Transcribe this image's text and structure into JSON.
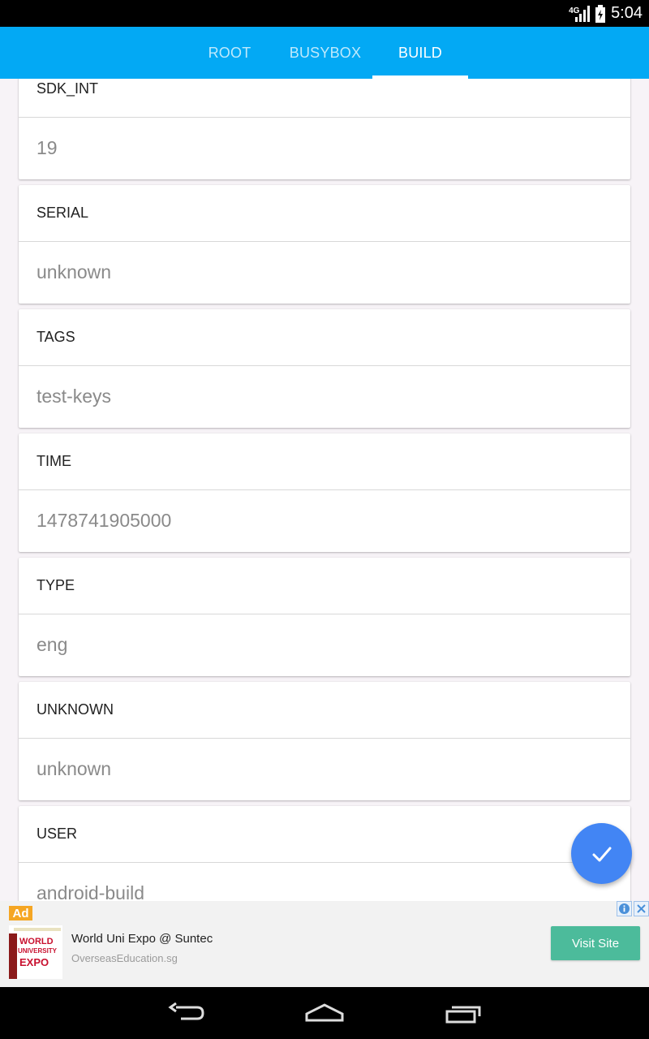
{
  "status_bar": {
    "network": "4G",
    "time": "5:04"
  },
  "tabs": [
    {
      "label": "ROOT",
      "active": false
    },
    {
      "label": "BUSYBOX",
      "active": false
    },
    {
      "label": "BUILD",
      "active": true
    }
  ],
  "cards": [
    {
      "label": "SDK_INT",
      "value": "19"
    },
    {
      "label": "SERIAL",
      "value": "unknown"
    },
    {
      "label": "TAGS",
      "value": "test-keys"
    },
    {
      "label": "TIME",
      "value": "1478741905000"
    },
    {
      "label": "TYPE",
      "value": "eng"
    },
    {
      "label": "UNKNOWN",
      "value": "unknown"
    },
    {
      "label": "USER",
      "value": "android-build"
    }
  ],
  "fab": {
    "icon": "check-icon"
  },
  "ad": {
    "badge": "Ad",
    "title": "World Uni Expo @ Suntec",
    "source": "OverseasEducation.sg",
    "button": "Visit Site",
    "image_text": [
      "WORLD",
      "UNIVERSITY",
      "EXPO"
    ]
  },
  "colors": {
    "tab_bar": "#03a9f4",
    "fab": "#4285f4",
    "ad_button": "#4cbb9b",
    "ad_badge": "#f5a623"
  }
}
